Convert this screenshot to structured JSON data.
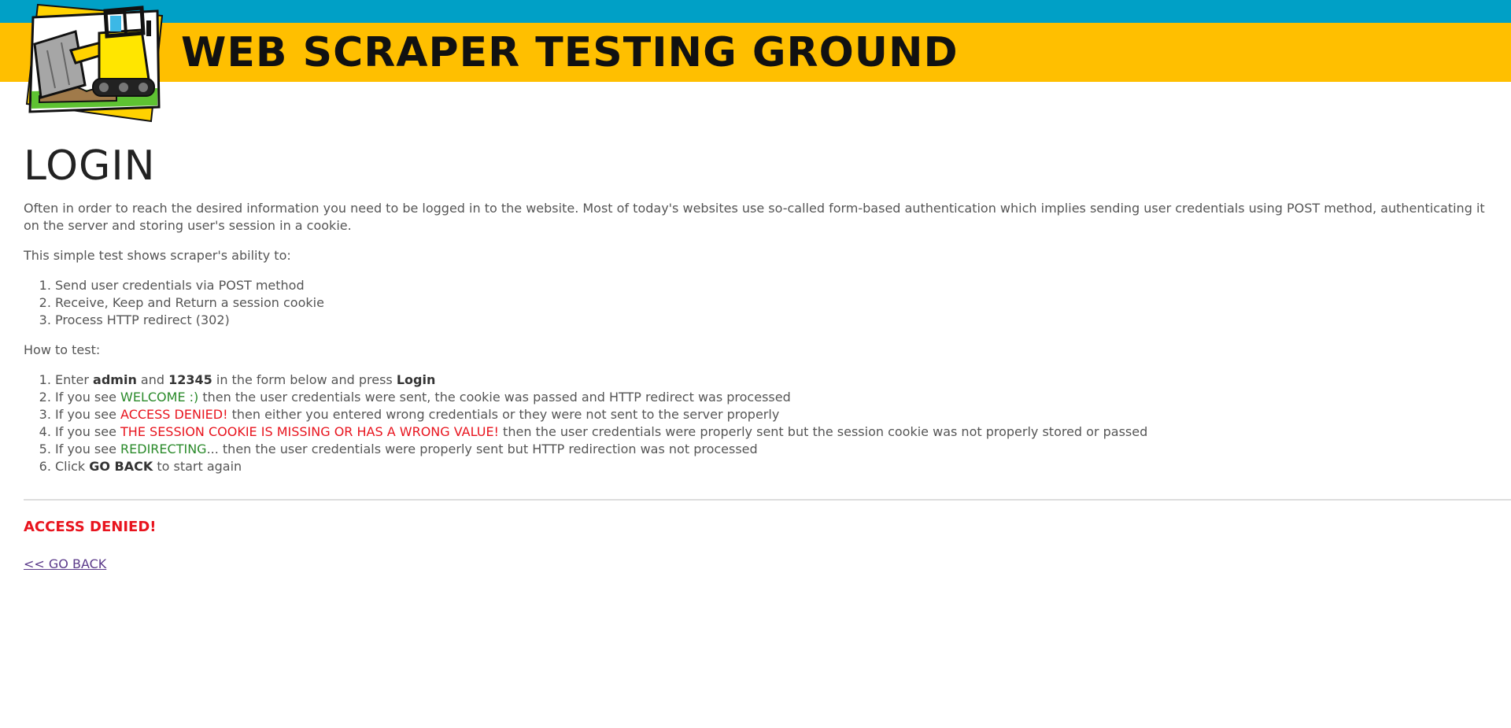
{
  "header": {
    "site_title": "WEB SCRAPER TESTING GROUND",
    "logo_icon": "bulldozer-icon",
    "colors": {
      "top_band": "#00a0c6",
      "yellow_band": "#ffbf00"
    }
  },
  "main": {
    "heading": "LOGIN",
    "intro": "Often in order to reach the desired information you need to be logged in to the website. Most of today's websites use so-called form-based authentication which implies sending user credentials using POST method, authenticating it on the server and storing user's session in a cookie.",
    "abilities_intro": "This simple test shows scraper's ability to:",
    "abilities": [
      "Send user credentials via POST method",
      "Receive, Keep and Return a session cookie",
      "Process HTTP redirect (302)"
    ],
    "how_to_intro": "How to test:",
    "steps": {
      "s1": {
        "pre": "Enter ",
        "b1": "admin",
        "mid1": " and ",
        "b2": "12345",
        "mid2": " in the form below and press ",
        "b3": "Login"
      },
      "s2": {
        "pre": "If you see ",
        "hl": "WELCOME :)",
        "post": " then the user credentials were sent, the cookie was passed and HTTP redirect was processed"
      },
      "s3": {
        "pre": "If you see ",
        "hl": "ACCESS DENIED!",
        "post": " then either you entered wrong credentials or they were not sent to the server properly"
      },
      "s4": {
        "pre": "If you see ",
        "hl": "THE SESSION COOKIE IS MISSING OR HAS A WRONG VALUE!",
        "post": " then the user credentials were properly sent but the session cookie was not properly stored or passed"
      },
      "s5": {
        "pre": "If you see ",
        "hl": "REDIRECTING",
        "post": "... then the user credentials were properly sent but HTTP redirection was not processed"
      },
      "s6": {
        "pre": "Click ",
        "b1": "GO BACK",
        "post": " to start again"
      }
    },
    "result_message": "ACCESS DENIED!",
    "go_back_link": "<< GO BACK",
    "colors": {
      "success": "#2a8a2a",
      "error": "#e8141e",
      "link": "#5b3a8a"
    }
  }
}
